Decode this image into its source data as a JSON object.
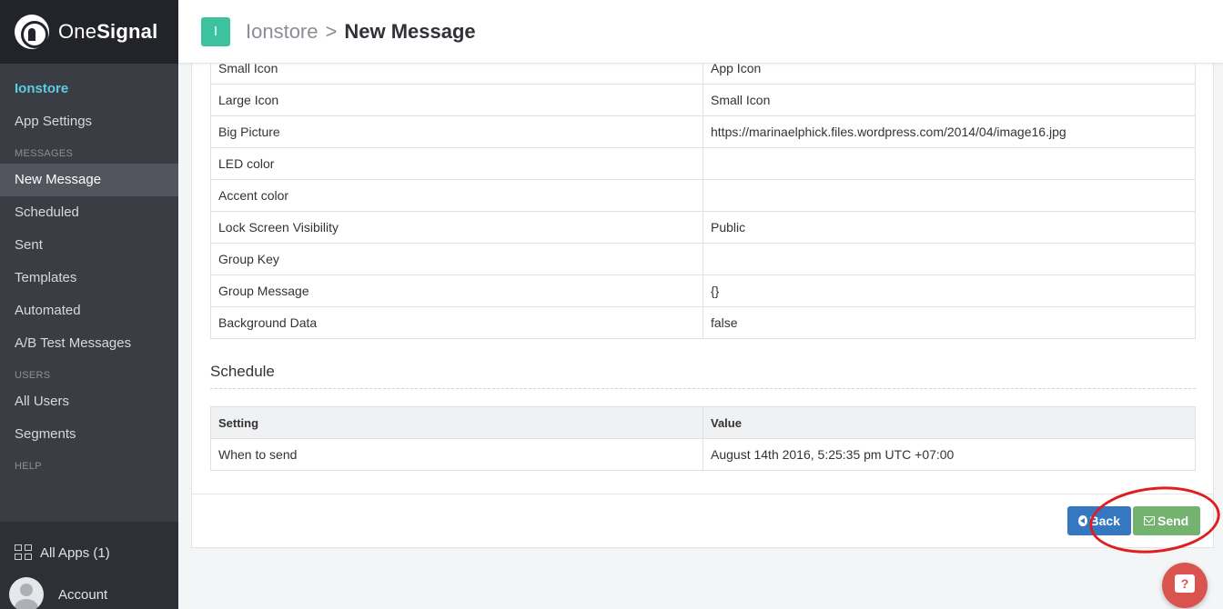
{
  "brand": {
    "name_regular": "One",
    "name_bold": "Signal"
  },
  "sidebar": {
    "app_name": "Ionstore",
    "app_settings": "App Settings",
    "messages_heading": "MESSAGES",
    "messages_items": [
      "New Message",
      "Scheduled",
      "Sent",
      "Templates",
      "Automated",
      "A/B Test Messages"
    ],
    "users_heading": "USERS",
    "users_items": [
      "All Users",
      "Segments"
    ],
    "help_heading": "HELP",
    "all_apps": "All Apps (1)",
    "account": "Account"
  },
  "header": {
    "app_badge": "I",
    "breadcrumb_app": "Ionstore",
    "breadcrumb_sep": ">",
    "breadcrumb_current": "New Message"
  },
  "options_table": {
    "rows": [
      {
        "setting": "Small Icon",
        "value": "App Icon"
      },
      {
        "setting": "Large Icon",
        "value": "Small Icon"
      },
      {
        "setting": "Big Picture",
        "value": "https://marinaelphick.files.wordpress.com/2014/04/image16.jpg"
      },
      {
        "setting": "LED color",
        "value": ""
      },
      {
        "setting": "Accent color",
        "value": ""
      },
      {
        "setting": "Lock Screen Visibility",
        "value": "Public"
      },
      {
        "setting": "Group Key",
        "value": ""
      },
      {
        "setting": "Group Message",
        "value": "{}"
      },
      {
        "setting": "Background Data",
        "value": "false"
      }
    ]
  },
  "schedule": {
    "title": "Schedule",
    "headers": {
      "setting": "Setting",
      "value": "Value"
    },
    "rows": [
      {
        "setting": "When to send",
        "value": "August 14th 2016, 5:25:35 pm UTC +07:00"
      }
    ]
  },
  "actions": {
    "back_label": "Back",
    "send_label": "Send"
  },
  "colors": {
    "accent": "#5ccde0",
    "app_badge": "#3cc29e",
    "back_button": "#3578c1",
    "send_button": "#73b26f",
    "highlight": "#e01e1e",
    "help": "#d9534f"
  }
}
